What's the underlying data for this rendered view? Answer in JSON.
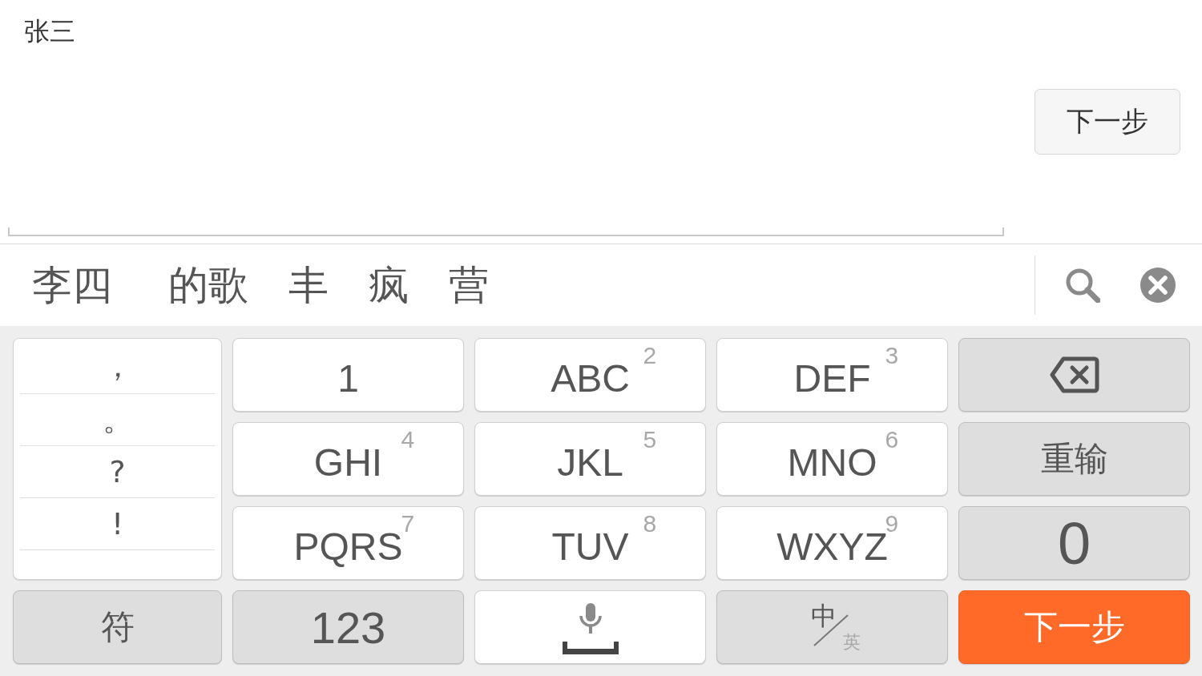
{
  "input": {
    "value": "张三"
  },
  "next_button": {
    "label": "下一步"
  },
  "candidates": [
    "李四",
    "的歌",
    "丰",
    "疯",
    "营"
  ],
  "keyboard": {
    "punctuation": [
      "，",
      "。",
      "?",
      "!"
    ],
    "keys": [
      {
        "kind": "letter",
        "label": "1"
      },
      {
        "kind": "letter",
        "label": "ABC",
        "digit": "2"
      },
      {
        "kind": "letter",
        "label": "DEF",
        "digit": "3"
      },
      {
        "kind": "backspace"
      },
      {
        "kind": "letter",
        "label": "GHI",
        "digit": "4"
      },
      {
        "kind": "letter",
        "label": "JKL",
        "digit": "5"
      },
      {
        "kind": "letter",
        "label": "MNO",
        "digit": "6"
      },
      {
        "kind": "function",
        "label": "重输"
      },
      {
        "kind": "letter",
        "label": "PQRS",
        "digit": "7"
      },
      {
        "kind": "letter",
        "label": "TUV",
        "digit": "8"
      },
      {
        "kind": "letter",
        "label": "WXYZ",
        "digit": "9"
      },
      {
        "kind": "digit",
        "label": "0"
      },
      {
        "kind": "function",
        "label": "符"
      },
      {
        "kind": "mode",
        "label": "123"
      },
      {
        "kind": "voice"
      },
      {
        "kind": "language",
        "options": [
          {
            "label": "中",
            "selected": true
          },
          {
            "label": "英",
            "selected": false
          }
        ]
      },
      {
        "kind": "action",
        "label": "下一步"
      }
    ]
  }
}
